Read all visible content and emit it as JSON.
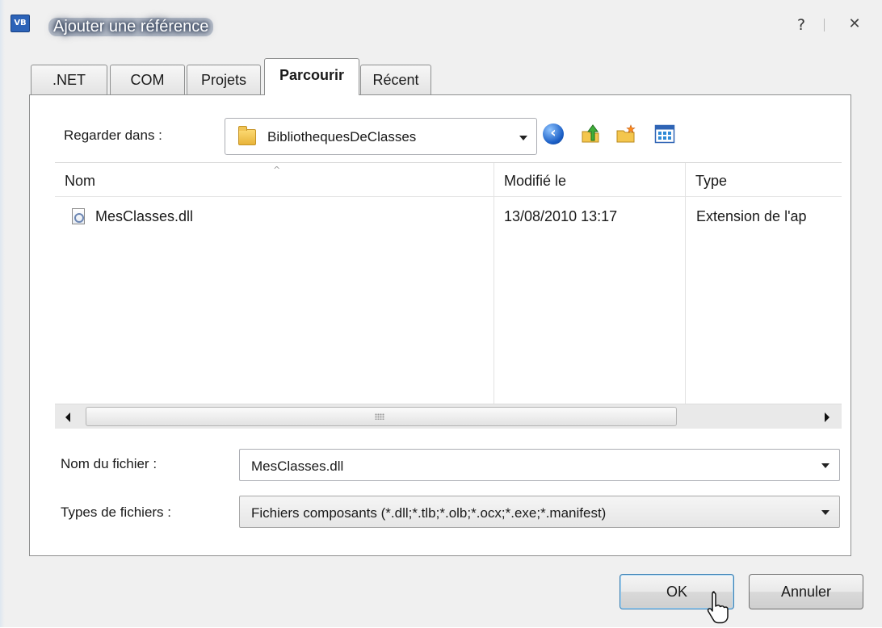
{
  "window": {
    "title": "Ajouter une référence",
    "app_icon_text": "VB",
    "help_glyph": "?",
    "close_glyph": "✕"
  },
  "tabs": [
    {
      "label": ".NET",
      "active": false
    },
    {
      "label": "COM",
      "active": false
    },
    {
      "label": "Projets",
      "active": false
    },
    {
      "label": "Parcourir",
      "active": true
    },
    {
      "label": "Récent",
      "active": false
    }
  ],
  "browse": {
    "look_in_label": "Regarder dans :",
    "look_in_value": "BibliothequesDeClasses",
    "toolbar_icons": [
      "back-icon",
      "up-folder-icon",
      "new-folder-icon",
      "views-menu-icon"
    ],
    "columns": [
      "Nom",
      "Modifié le",
      "Type"
    ],
    "files": [
      {
        "name": "MesClasses.dll",
        "modified": "13/08/2010 13:17",
        "type": "Extension de l'ap",
        "icon": "dll-file-icon"
      }
    ],
    "filename_label": "Nom du fichier :",
    "filename_value": "MesClasses.dll",
    "filetype_label": "Types de fichiers :",
    "filetype_value": "Fichiers composants (*.dll;*.tlb;*.olb;*.ocx;*.exe;*.manifest)"
  },
  "buttons": {
    "ok": "OK",
    "cancel": "Annuler"
  },
  "colors": {
    "dialog_bg": "#f0f0f0",
    "panel_bg": "#ffffff",
    "tab_border": "#8e8f8f",
    "default_button_border": "#3c7fb1"
  }
}
